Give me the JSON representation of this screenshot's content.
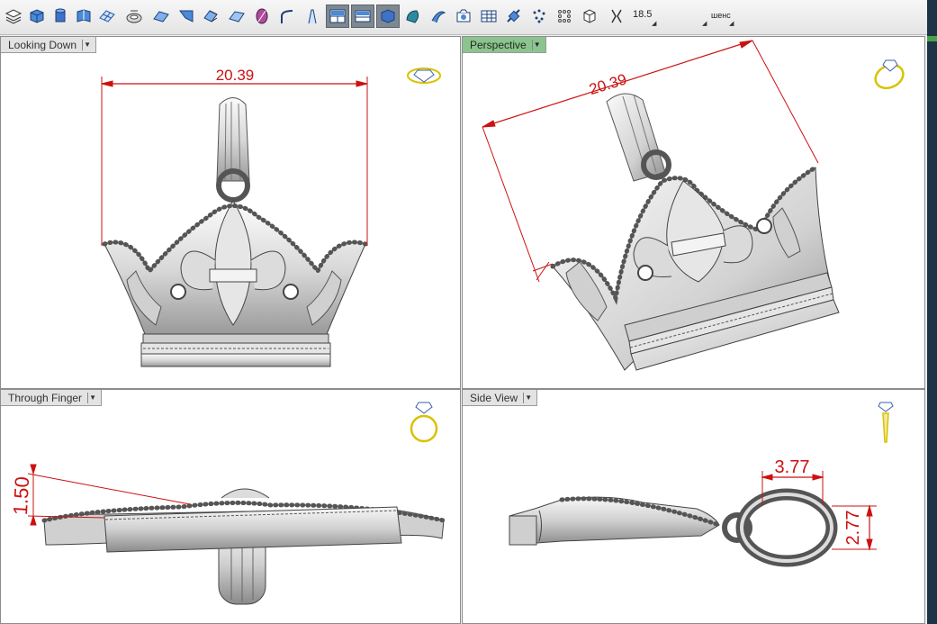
{
  "toolbar": {
    "icons": [
      "layers-icon",
      "box-icon",
      "cylinder-icon",
      "book-icon",
      "grid-plane-icon",
      "torus-icon",
      "plane-icon",
      "fold-icon",
      "sheet-icon",
      "ellipse-icon",
      "curve-icon",
      "loft-icon",
      "viewport-layout-icon",
      "viewport-2-icon",
      "viewport-3d-icon",
      "sphere-shade-icon",
      "swirl-icon",
      "camera-icon",
      "frame-icon",
      "sattelite-icon",
      "point-cloud-icon",
      "scatter-icon",
      "cube-icon",
      "bracket-icon"
    ],
    "zoom_value": "18.5",
    "label_value": "шенс"
  },
  "viewports": {
    "top_left": {
      "title": "Looking Down",
      "dims": [
        "20.39"
      ]
    },
    "top_right": {
      "title": "Perspective",
      "dims": [
        "20.39"
      ]
    },
    "bottom_left": {
      "title": "Through Finger",
      "dims": [
        "1.50"
      ]
    },
    "bottom_right": {
      "title": "Side View",
      "dims": [
        "3.77",
        "2.77"
      ]
    }
  },
  "colors": {
    "dimension": "#cc1111",
    "active_tab": "#8cc48f",
    "gizmo": "#d8c200"
  }
}
